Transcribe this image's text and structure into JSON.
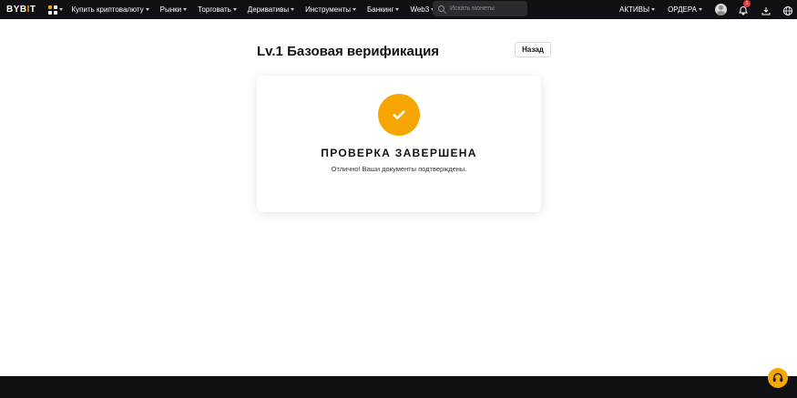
{
  "header": {
    "logo_text": "BYB",
    "logo_bar": "I",
    "logo_tail": "T",
    "nav": [
      {
        "label": "Купить криптовалюту"
      },
      {
        "label": "Рынки"
      },
      {
        "label": "Торговать"
      },
      {
        "label": "Деривативы"
      },
      {
        "label": "Инструменты"
      },
      {
        "label": "Банкинг"
      },
      {
        "label": "Web3"
      }
    ],
    "search_placeholder": "Искать монеты",
    "assets_label": "АКТИВЫ",
    "orders_label": "ОРДЕРА",
    "notification_count": "1"
  },
  "main": {
    "title": "Lv.1 Базовая верификация",
    "back_label": "Назад",
    "status_title": "ПРОВЕРКА ЗАВЕРШЕНА",
    "status_message": "Отлично! Ваши документы подтверждены."
  },
  "colors": {
    "brand": "#f7a600",
    "topbar": "#101014",
    "badge": "#e5383b"
  }
}
